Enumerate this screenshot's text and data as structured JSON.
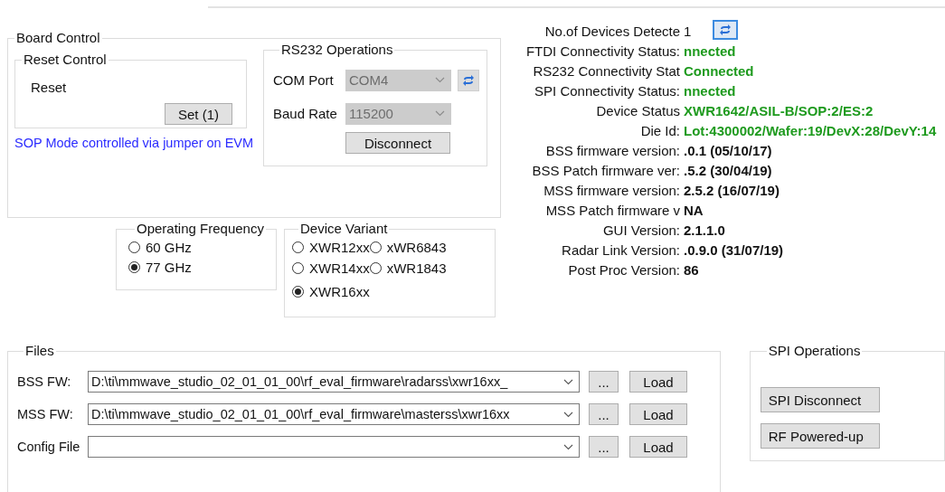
{
  "board_control": {
    "title": "Board Control",
    "reset_control": {
      "title": "Reset Control",
      "label": "Reset",
      "button": "Set (1)"
    },
    "note": "SOP Mode controlled via jumper on EVM",
    "rs232": {
      "title": "RS232 Operations",
      "fields": [
        {
          "label": "COM Port",
          "value": "COM4",
          "disabled": true,
          "refresh": true
        },
        {
          "label": "Baud Rate",
          "value": "115200",
          "disabled": true,
          "refresh": false
        }
      ],
      "button": "Disconnect"
    }
  },
  "operating_frequency": {
    "title": "Operating Frequency",
    "options": [
      {
        "label": "60 GHz",
        "selected": false
      },
      {
        "label": "77 GHz",
        "selected": true
      }
    ]
  },
  "device_variant": {
    "title": "Device Variant",
    "options": [
      {
        "label": "XWR12xx",
        "selected": false
      },
      {
        "label": "xWR6843",
        "selected": false
      },
      {
        "label": "XWR14xx",
        "selected": false
      },
      {
        "label": "xWR1843",
        "selected": false
      },
      {
        "label": "XWR16xx",
        "selected": true
      }
    ]
  },
  "device_info": {
    "rows": [
      {
        "label": "No.of Devices Detecte",
        "value": "1",
        "kind": "count",
        "refresh": true
      },
      {
        "label": "FTDI Connectivity Status:",
        "value": "nnected",
        "kind": "status"
      },
      {
        "label": "RS232 Connectivity Stat",
        "value": "Connected",
        "kind": "status"
      },
      {
        "label": "SPI Connectivity Status:",
        "value": "nnected",
        "kind": "status"
      },
      {
        "label": "Device Status",
        "value": "XWR1642/ASIL-B/SOP:2/ES:2",
        "kind": "status"
      },
      {
        "label": "Die Id:",
        "value": "Lot:4300002/Wafer:19/DevX:28/DevY:14",
        "kind": "status"
      },
      {
        "label": "BSS firmware version:",
        "value": ".0.1 (05/10/17)",
        "kind": "version"
      },
      {
        "label": "BSS Patch firmware ver:",
        "value": ".5.2 (30/04/19)",
        "kind": "version"
      },
      {
        "label": "MSS firmware version:",
        "value": "2.5.2 (16/07/19)",
        "kind": "version"
      },
      {
        "label": "MSS Patch firmware v",
        "value": "NA",
        "kind": "version"
      },
      {
        "label": "GUI Version:",
        "value": "2.1.1.0",
        "kind": "version"
      },
      {
        "label": "Radar Link Version:",
        "value": ".0.9.0 (31/07/19)",
        "kind": "version"
      },
      {
        "label": "Post Proc Version:",
        "value": "86",
        "kind": "version"
      }
    ]
  },
  "files": {
    "title": "Files",
    "rows": [
      {
        "label": "BSS FW:",
        "value": "D:\\ti\\mmwave_studio_02_01_01_00\\rf_eval_firmware\\radarss\\xwr16xx_",
        "browse": "...",
        "load": "Load"
      },
      {
        "label": "MSS FW:",
        "value": "D:\\ti\\mmwave_studio_02_01_01_00\\rf_eval_firmware\\masterss\\xwr16xx",
        "browse": "...",
        "load": "Load"
      },
      {
        "label": "Config File",
        "browse": "...",
        "load": "Load"
      }
    ]
  },
  "spi_operations": {
    "title": "SPI Operations",
    "buttons": [
      "SPI Disconnect",
      "RF Powered-up"
    ]
  }
}
